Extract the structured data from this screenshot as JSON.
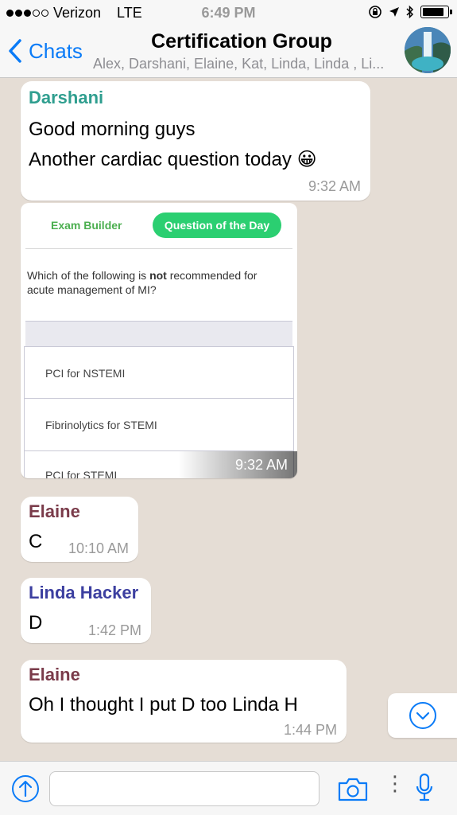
{
  "status_bar": {
    "carrier": "Verizon",
    "network": "LTE",
    "time": "6:49 PM"
  },
  "header": {
    "back_label": "Chats",
    "title": "Certification Group",
    "subtitle": "Alex, Darshani, Elaine, Kat, Linda, Linda , Li..."
  },
  "messages": [
    {
      "sender": "Darshani",
      "lines": [
        "Good morning guys",
        "Another cardiac question today"
      ],
      "emoji": "😀",
      "time": "9:32 AM",
      "sender_color": "#2f9e8f"
    },
    {
      "type": "image",
      "time": "9:32 AM"
    },
    {
      "sender": "Elaine",
      "text": "C",
      "time": "10:10 AM",
      "sender_color": "#7a3b4a"
    },
    {
      "sender": "Linda Hacker",
      "text": "D",
      "time": "1:42 PM",
      "sender_color": "#3c3fa0"
    },
    {
      "sender": "Elaine",
      "text": "Oh I thought I put D too Linda H",
      "time": "1:44 PM",
      "sender_color": "#7a3b4a"
    }
  ],
  "quiz_card": {
    "tab_exam": "Exam Builder",
    "tab_qotd": "Question of the Day",
    "question_before": "Which of the following is ",
    "question_bold": "not",
    "question_after": " recommended for acute management of MI?",
    "options": [
      "PCI for NSTEMI",
      "Fibrinolytics for STEMI",
      "PCI for STEMI"
    ]
  },
  "input": {
    "value": ""
  },
  "colors": {
    "ios_blue": "#0a7bf7",
    "chat_bg": "#e5ddd5",
    "qotd_green": "#2bcf71"
  },
  "icons": [
    "chevron-left-icon",
    "chevron-down-circle-icon",
    "arrow-up-circle-icon",
    "camera-icon",
    "microphone-icon"
  ]
}
